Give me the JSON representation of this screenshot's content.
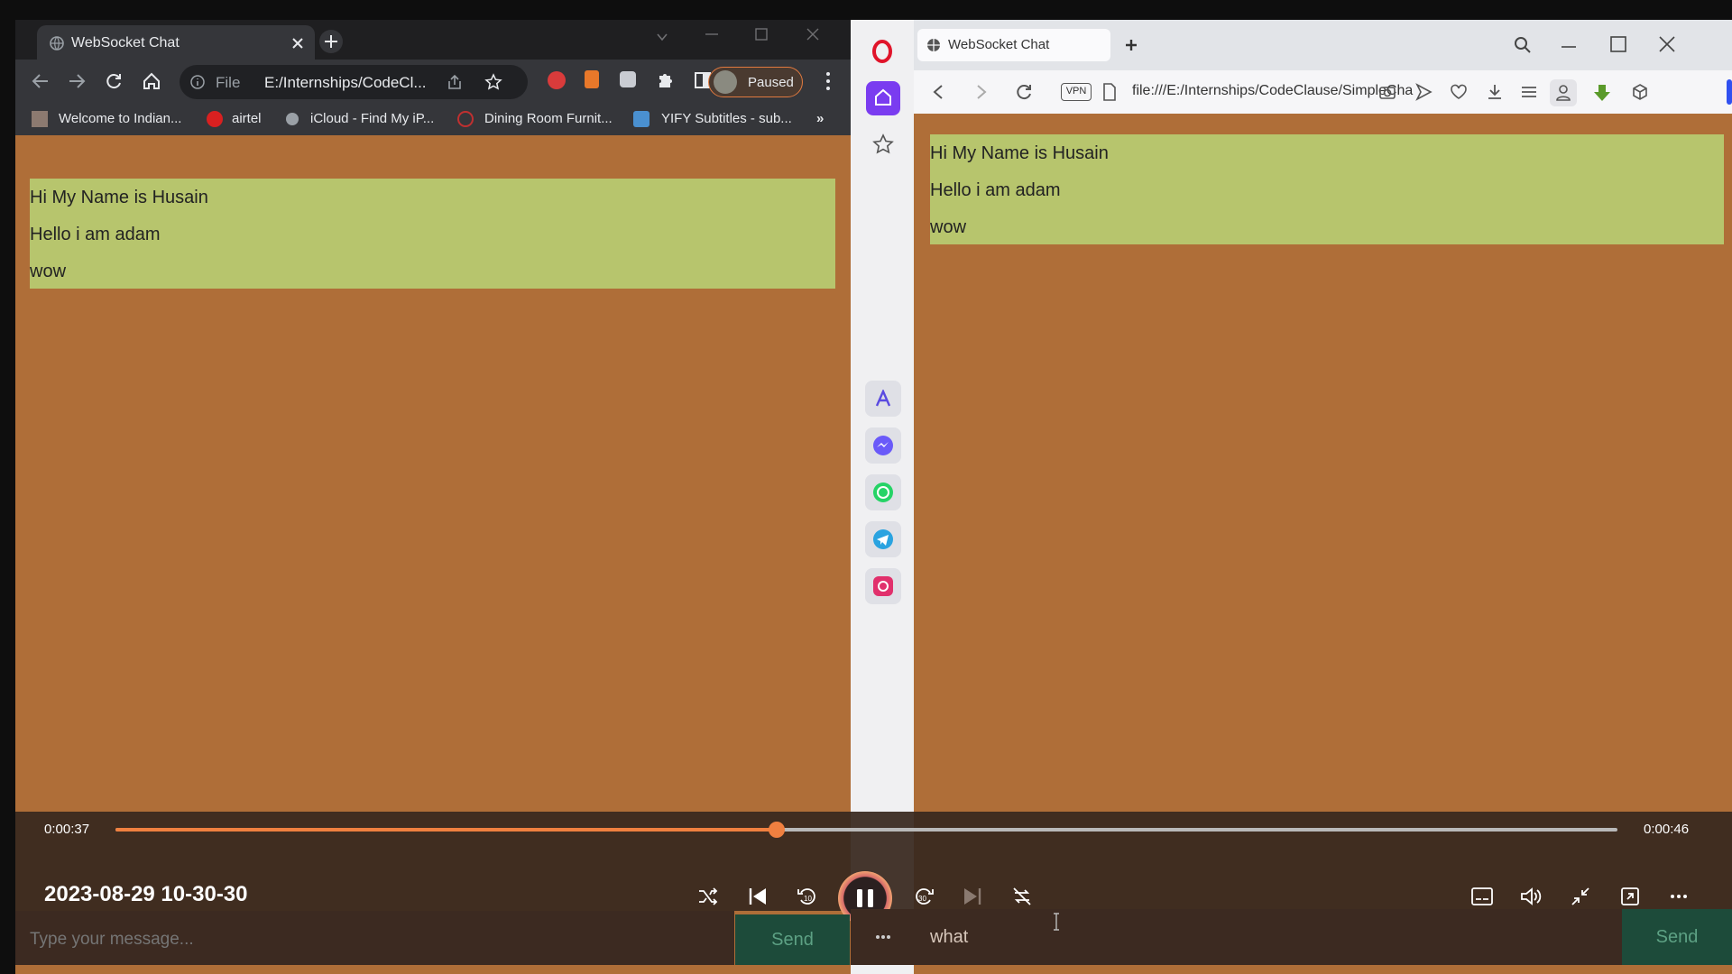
{
  "left_browser": {
    "tab_title": "WebSocket Chat",
    "omnibox_scheme": "File",
    "omnibox_url": "E:/Internships/CodeCl...",
    "profile_status": "Paused",
    "bookmarks": [
      "Welcome to Indian...",
      "airtel",
      "iCloud - Find My iP...",
      "Dining Room Furnit...",
      "YIFY Subtitles - sub...",
      "»"
    ],
    "messages": [
      "Hi My Name is Husain",
      "Hello i am adam",
      "wow"
    ],
    "input_placeholder": "Type your message...",
    "send_label": "Send"
  },
  "right_browser": {
    "tab_title": "WebSocket Chat",
    "vpn_badge": "VPN",
    "url": "file:///E:/Internships/CodeClause/SimpleCha",
    "messages": [
      "Hi My Name is Husain",
      "Hello i am adam",
      "wow"
    ],
    "input_value": "what",
    "send_label": "Send",
    "sidebar_icons": [
      "opera-logo-icon",
      "home-icon",
      "star-icon",
      "aria-icon",
      "messenger-icon",
      "whatsapp-icon",
      "telegram-icon",
      "instagram-icon",
      "more-icon"
    ]
  },
  "player": {
    "elapsed": "0:00:37",
    "total": "0:00:46",
    "progress": 0.44,
    "datetime": "2023-08-29 10-30-30",
    "accent_color": "#f08040"
  },
  "colors": {
    "page_bg": "#af6e38",
    "chat_box": "#b7c56d",
    "send_bg": "#1d4b3a"
  }
}
